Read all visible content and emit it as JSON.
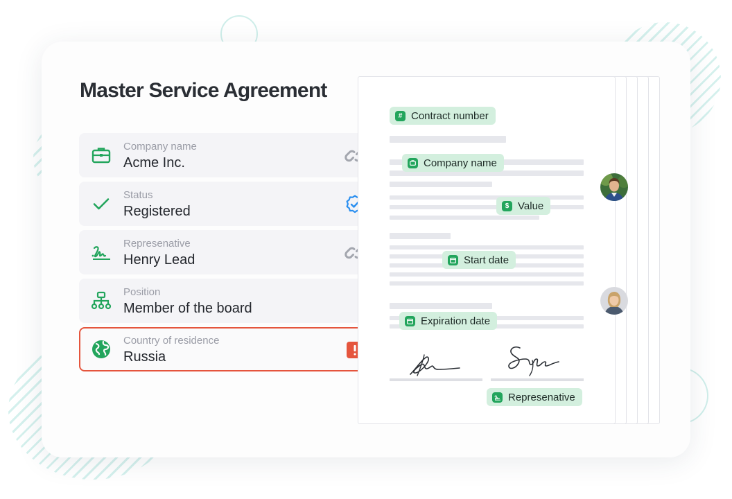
{
  "document": {
    "title": "Master Service Agreement"
  },
  "fields": [
    {
      "label": "Company name",
      "value": "Acme Inc.",
      "icon": "briefcase-icon",
      "action_icon": "link-icon"
    },
    {
      "label": "Status",
      "value": "Registered",
      "icon": "check-icon",
      "action_icon": "verified-badge-icon"
    },
    {
      "label": "Represenative",
      "value": "Henry Lead",
      "icon": "signature-icon",
      "action_icon": "link-icon"
    },
    {
      "label": "Position",
      "value": "Member of the board",
      "icon": "org-chart-icon"
    },
    {
      "label": "Country of residence",
      "value": "Russia",
      "icon": "globe-icon",
      "action_icon": "error-icon",
      "state": "error"
    }
  ],
  "preview": {
    "tags": {
      "contract_number": "Contract number",
      "company_name": "Company name",
      "value": "Value",
      "start_date": "Start date",
      "expiration_date": "Expiration date",
      "representative": "Represenative"
    }
  },
  "colors": {
    "accent_green": "#22a55c",
    "tag_background": "#d3efde",
    "error_red": "#e5553d",
    "verified_blue": "#2a8ff0",
    "decor_mint": "#cfeeea"
  }
}
